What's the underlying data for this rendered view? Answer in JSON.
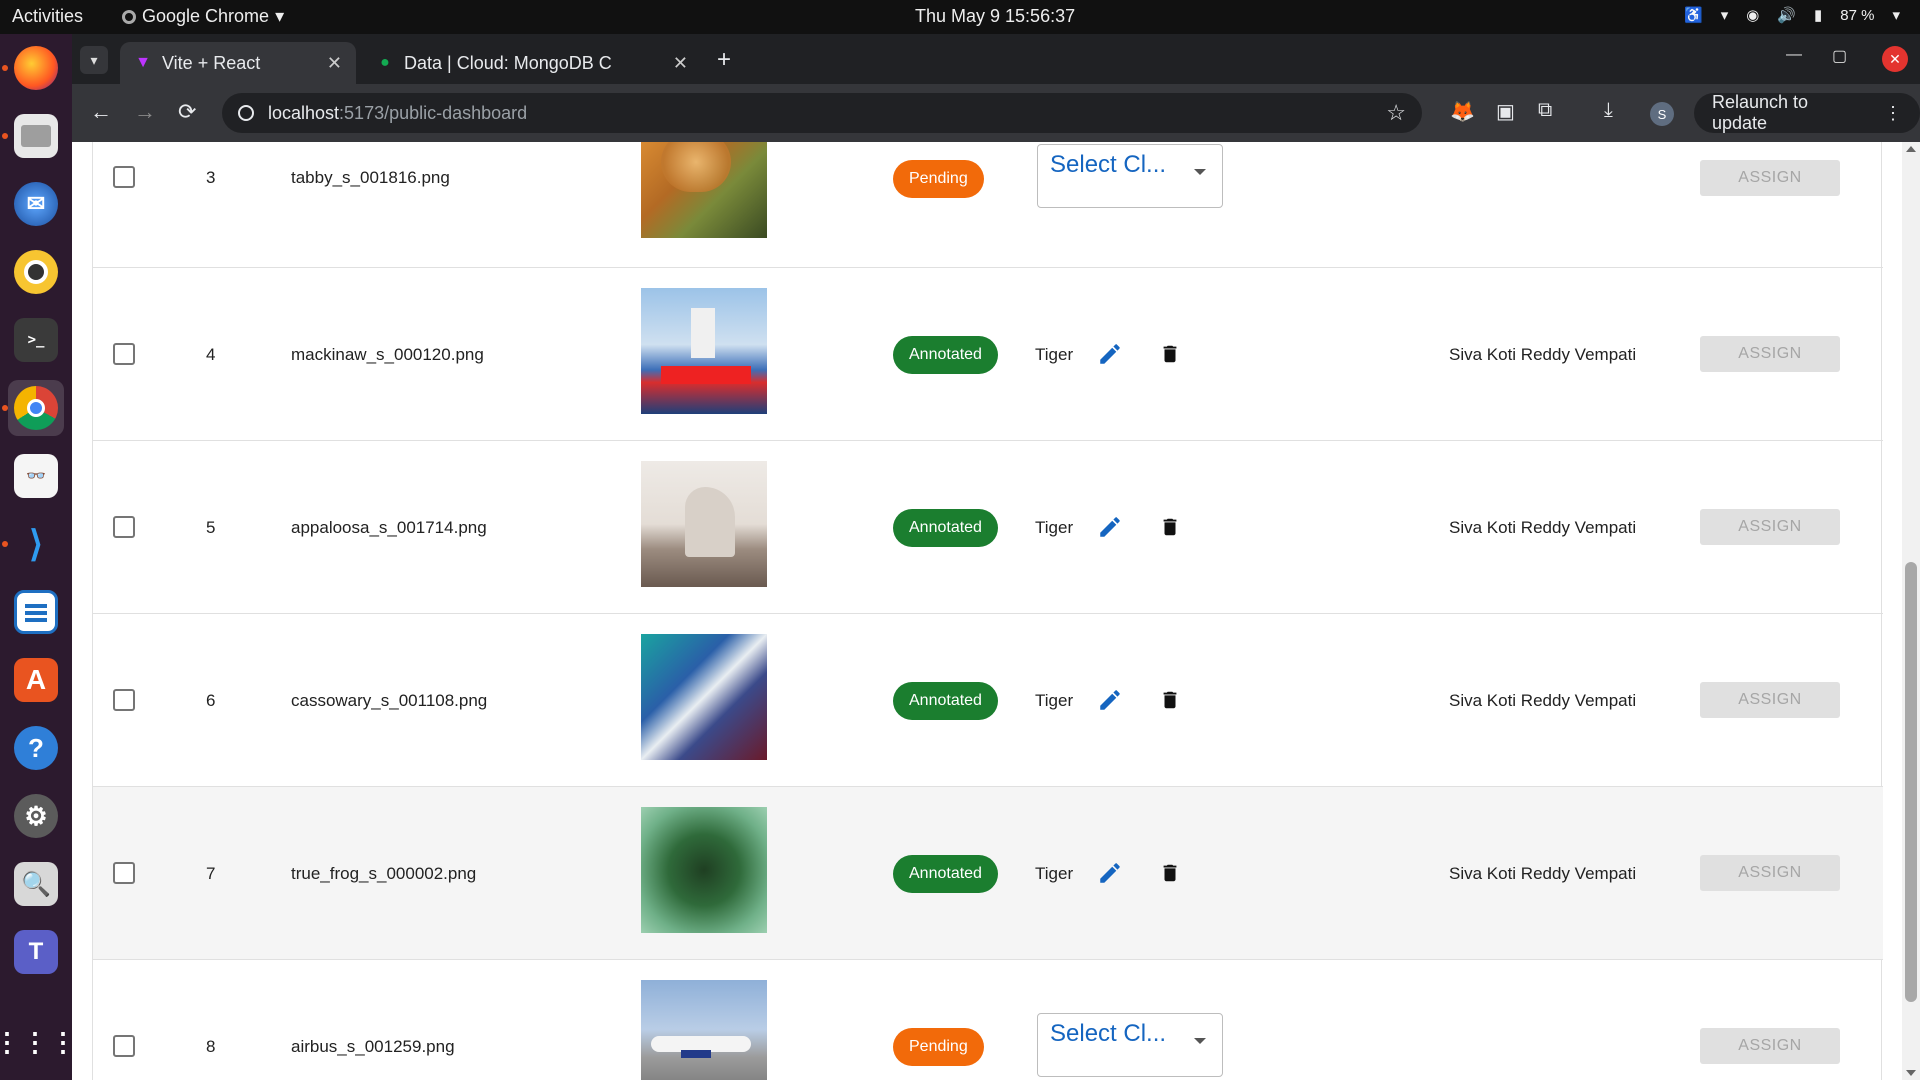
{
  "topbar": {
    "activities": "Activities",
    "app_name": "Google Chrome",
    "clock": "Thu May 9  15:56:37",
    "battery": "87 %"
  },
  "dock": {
    "items": [
      "firefox-icon",
      "files-icon",
      "thunderbird-icon",
      "rhythmbox-icon",
      "terminal-icon",
      "chrome-icon",
      "document-viewer-icon",
      "vscode-icon",
      "writer-icon",
      "app-center-icon",
      "help-icon",
      "settings-icon",
      "image-viewer-icon",
      "teams-icon",
      "show-apps-icon"
    ]
  },
  "browser": {
    "tabs": [
      {
        "title": "Vite + React",
        "active": true
      },
      {
        "title": "Data | Cloud: MongoDB C",
        "active": false
      }
    ],
    "url_host": "localhost",
    "url_path": ":5173/public-dashboard",
    "relaunch_label": "Relaunch to update",
    "profile_initial": "S"
  },
  "table": {
    "rows": [
      {
        "num": "3",
        "file": "tabby_s_001816.png",
        "status": "Pending",
        "label": "",
        "select_value": "Select Cl...",
        "annotator": "",
        "assign": "ASSIGN"
      },
      {
        "num": "4",
        "file": "mackinaw_s_000120.png",
        "status": "Annotated",
        "label": "Tiger",
        "select_value": "",
        "annotator": "Siva Koti Reddy Vempati",
        "assign": "ASSIGN"
      },
      {
        "num": "5",
        "file": "appaloosa_s_001714.png",
        "status": "Annotated",
        "label": "Tiger",
        "select_value": "",
        "annotator": "Siva Koti Reddy Vempati",
        "assign": "ASSIGN"
      },
      {
        "num": "6",
        "file": "cassowary_s_001108.png",
        "status": "Annotated",
        "label": "Tiger",
        "select_value": "",
        "annotator": "Siva Koti Reddy Vempati",
        "assign": "ASSIGN"
      },
      {
        "num": "7",
        "file": "true_frog_s_000002.png",
        "status": "Annotated",
        "label": "Tiger",
        "select_value": "",
        "annotator": "Siva Koti Reddy Vempati",
        "assign": "ASSIGN"
      },
      {
        "num": "8",
        "file": "airbus_s_001259.png",
        "status": "Pending",
        "label": "",
        "select_value": "Select Cl...",
        "annotator": "",
        "assign": "ASSIGN"
      }
    ]
  },
  "colors": {
    "pending": "#f26a0a",
    "annotated": "#1b7e2f",
    "edit_icon": "#1565c0",
    "dock_bg": "#2c1a2e"
  }
}
